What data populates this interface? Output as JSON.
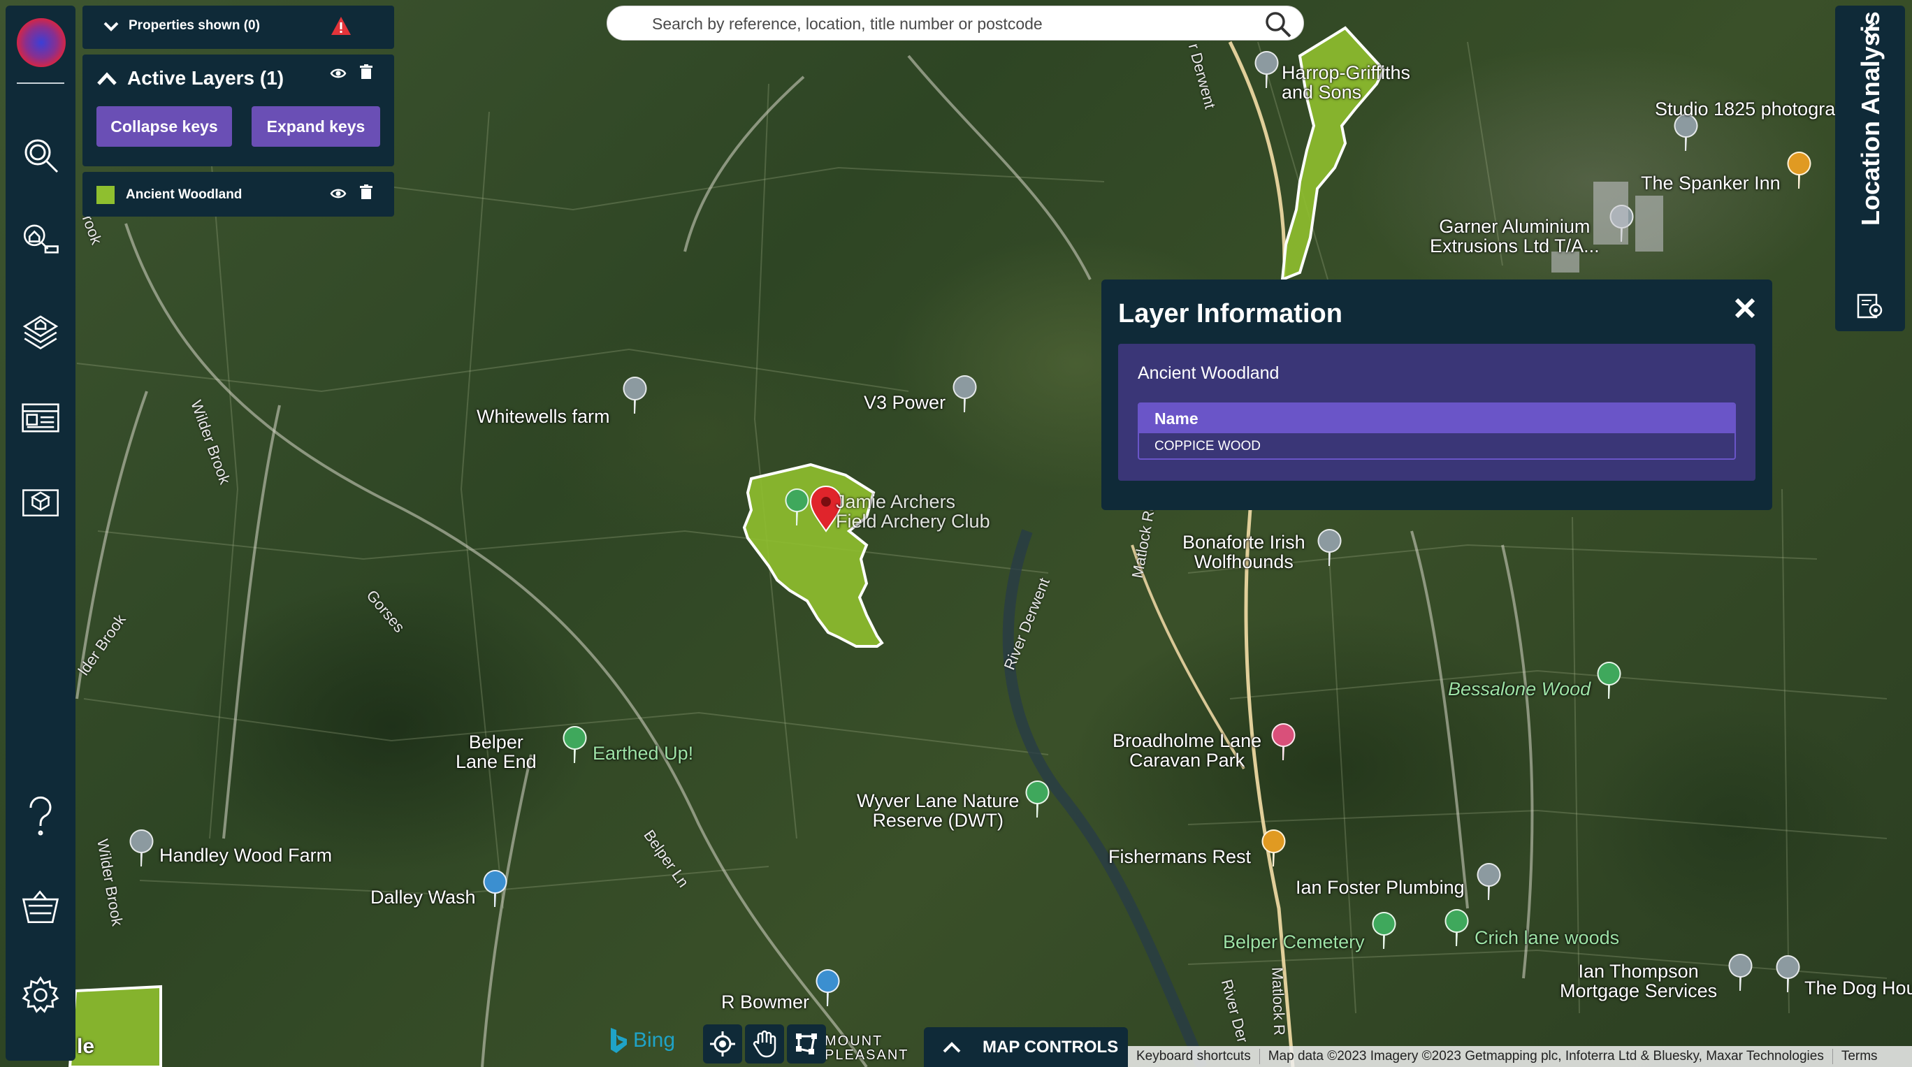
{
  "search": {
    "placeholder": "Search by reference, location, title number or postcode"
  },
  "sidebar": {
    "items": [
      {
        "name": "app-logo"
      },
      {
        "name": "search-area-icon"
      },
      {
        "name": "search-property-icon"
      },
      {
        "name": "layers-icon"
      },
      {
        "name": "report-card-icon"
      },
      {
        "name": "map-book-icon"
      },
      {
        "name": "help-icon"
      },
      {
        "name": "basket-icon"
      },
      {
        "name": "settings-icon"
      }
    ]
  },
  "properties_panel": {
    "label": "Properties shown (0)",
    "warning_icon": "warning-triangle-icon"
  },
  "active_layers": {
    "title": "Active Layers (1)",
    "collapse_label": "Collapse keys",
    "expand_label": "Expand keys",
    "layers": [
      {
        "label": "Ancient Woodland",
        "swatch": "#8fbf2f"
      }
    ]
  },
  "layer_info": {
    "title": "Layer Information",
    "layer_name": "Ancient Woodland",
    "attr_header": "Name",
    "attr_value": "COPPICE WOOD"
  },
  "location_panel": {
    "title": "Location Analysis"
  },
  "map": {
    "labels": [
      {
        "text": "Whitewells farm"
      },
      {
        "text": "V3 Power"
      },
      {
        "text": "Belper\nLane End"
      },
      {
        "text": "Earthed Up!"
      },
      {
        "text": "Handley Wood Farm"
      },
      {
        "text": "Dalley Wash"
      },
      {
        "text": "Wyver Lane Nature\nReserve (DWT)"
      },
      {
        "text": "R Bowmer"
      },
      {
        "text": "Bonaforte Irish\nWolfhounds"
      },
      {
        "text": "Broadholme Lane\nCaravan Park"
      },
      {
        "text": "Fishermans Rest"
      },
      {
        "text": "Ian Foster Plumbing"
      },
      {
        "text": "Belper Cemetery"
      },
      {
        "text": "Crich lane woods"
      },
      {
        "text": "Ian Thompson\nMortgage Services"
      },
      {
        "text": "The Dog Hou"
      },
      {
        "text": "Studio 1825 photogra"
      },
      {
        "text": "The Spanker Inn"
      },
      {
        "text": "Garner Aluminium\nExtrusions Ltd T/A..."
      },
      {
        "text": "Harrop-Griffiths\nand Sons"
      },
      {
        "text": "Bessalone Wood"
      },
      {
        "text": "Jamie Archers\nField Archery Club"
      },
      {
        "text": "MOUNT\nPLEASANT"
      }
    ],
    "roads": [
      {
        "text": "Wilder Brook"
      },
      {
        "text": "Gorses"
      },
      {
        "text": "Belper Ln"
      },
      {
        "text": "River Derwent"
      },
      {
        "text": "Matlock Rd"
      },
      {
        "text": "Wilder Brook"
      },
      {
        "text": "lder Brook"
      },
      {
        "text": "River Der"
      },
      {
        "text": "Matlock R"
      },
      {
        "text": "r Derwent"
      },
      {
        "text": "rook"
      }
    ],
    "woodland_color": "#8fbf2f",
    "partial_label": "le"
  },
  "bottom": {
    "bing": "Bing",
    "map_controls": "MAP CONTROLS",
    "attribution": [
      "Keyboard shortcuts",
      "Map data ©2023 Imagery ©2023 Getmapping plc, Infoterra Ltd & Bluesky, Maxar Technologies",
      "Terms"
    ]
  }
}
